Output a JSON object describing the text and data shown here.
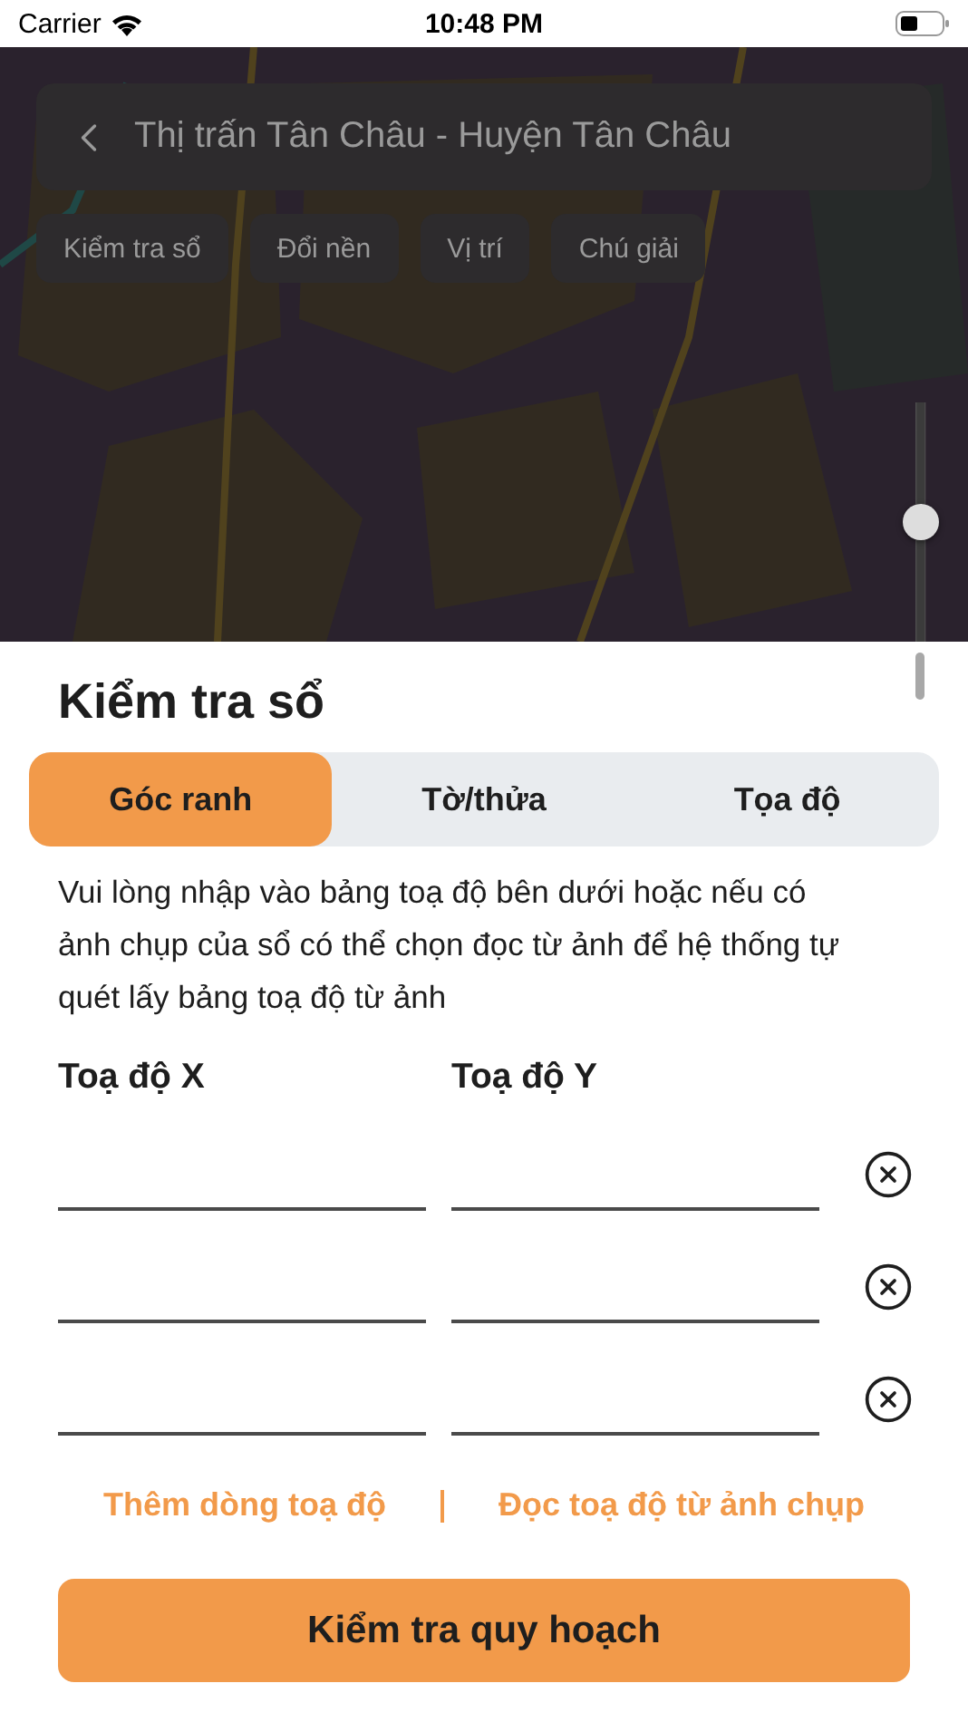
{
  "status_bar": {
    "carrier": "Carrier",
    "time": "10:48 PM"
  },
  "map": {
    "kind": "picture",
    "search_title": "Thị trấn Tân Châu - Huyện Tân Châu",
    "chips": [
      "Kiểm tra sổ",
      "Đổi nền",
      "Vị trí",
      "Chú giải"
    ],
    "zoom": {
      "level": 0.5
    }
  },
  "sheet": {
    "title": "Kiểm tra sổ",
    "tabs": [
      {
        "label": "Góc ranh",
        "selected": true
      },
      {
        "label": "Tờ/thửa",
        "selected": false
      },
      {
        "label": "Tọa độ",
        "selected": false
      }
    ],
    "instructions": "Vui lòng nhập vào bảng toạ độ bên dưới hoặc nếu có ảnh chụp của sổ có thể chọn đọc từ ảnh để hệ thống tự quét lấy bảng toạ độ từ ảnh",
    "columns": [
      "Toạ độ X",
      "Toạ độ Y"
    ],
    "rows": [
      {
        "kind": "coordinate"
      },
      {
        "kind": "coordinate"
      },
      {
        "kind": "coordinate"
      }
    ],
    "links": [
      "Thêm dòng toạ độ",
      "Đọc toạ độ từ ảnh chụp"
    ],
    "submit": "Kiểm tra quy hoạch"
  }
}
